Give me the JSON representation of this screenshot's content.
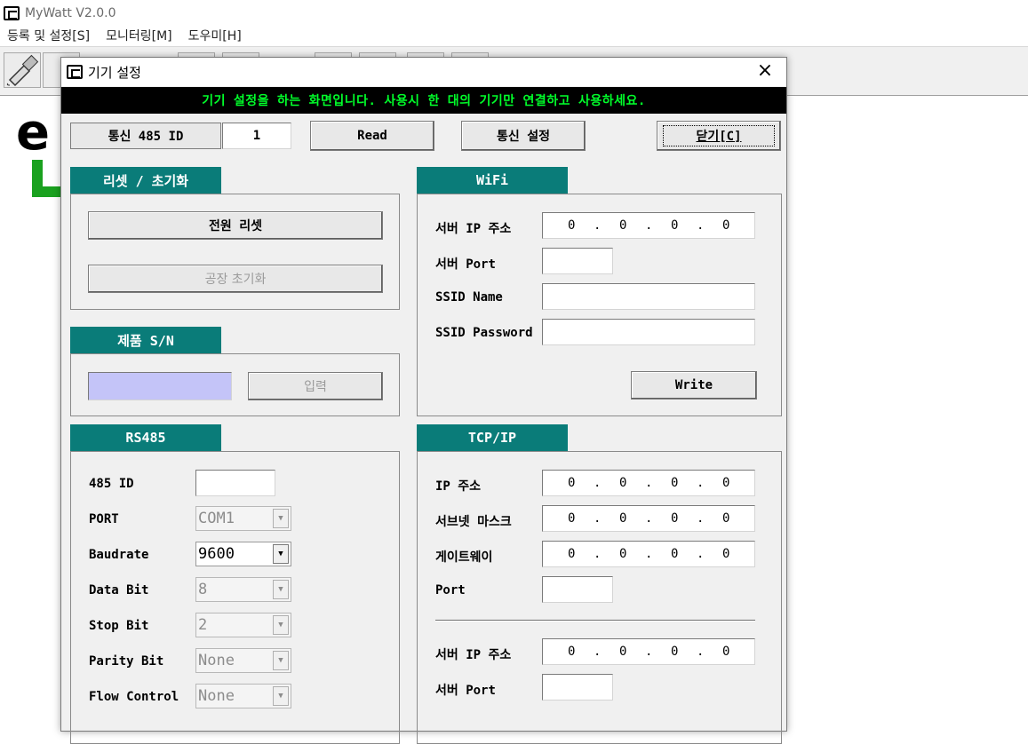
{
  "app": {
    "title": "MyWatt V2.0.0",
    "menu": [
      "등록 및 설정[S]",
      "모니터링[M]",
      "도우미[H]"
    ]
  },
  "dialog": {
    "title": "기기 설정",
    "close": "×",
    "banner": "기기 설정을 하는 화면입니다. 사용시 한 대의 기기만 연결하고 사용하세요.",
    "top": {
      "comm_label": "통신 485 ID",
      "comm_value": "1",
      "read": "Read",
      "comm_settings": "통신 설정",
      "close_button": "닫기[C]"
    },
    "reset": {
      "title": "리셋 / 초기화",
      "power_reset": "전원 리셋",
      "factory_reset": "공장 초기화"
    },
    "serial": {
      "title": "제품 S/N",
      "value": "",
      "input_button": "입력"
    },
    "rs485": {
      "title": "RS485",
      "id_label": "485 ID",
      "id_value": "",
      "port_label": "PORT",
      "port_value": "COM1",
      "baud_label": "Baudrate",
      "baud_value": "9600",
      "databit_label": "Data Bit",
      "databit_value": "8",
      "stopbit_label": "Stop Bit",
      "stopbit_value": "2",
      "parity_label": "Parity Bit",
      "parity_value": "None",
      "flow_label": "Flow Control",
      "flow_value": "None"
    },
    "wifi": {
      "title": "WiFi",
      "server_ip_label": "서버 IP 주소",
      "server_ip": [
        "0",
        "0",
        "0",
        "0"
      ],
      "server_port_label": "서버 Port",
      "server_port": "",
      "ssid_name_label": "SSID Name",
      "ssid_name": "",
      "ssid_password_label": "SSID Password",
      "ssid_password": "",
      "write": "Write"
    },
    "tcpip": {
      "title": "TCP/IP",
      "ip_label": "IP 주소",
      "ip": [
        "0",
        "0",
        "0",
        "0"
      ],
      "subnet_label": "서브넷 마스크",
      "subnet": [
        "0",
        "0",
        "0",
        "0"
      ],
      "gateway_label": "게이트웨이",
      "gateway": [
        "0",
        "0",
        "0",
        "0"
      ],
      "port_label": "Port",
      "port": "",
      "server_ip_label": "서버 IP 주소",
      "server_ip": [
        "0",
        "0",
        "0",
        "0"
      ],
      "server_port_label": "서버 Port",
      "server_port": ""
    }
  },
  "colors": {
    "group_title_bg": "#0a7c79",
    "banner_text": "#00ff2a",
    "serial_field_bg": "#c4c4f8"
  }
}
